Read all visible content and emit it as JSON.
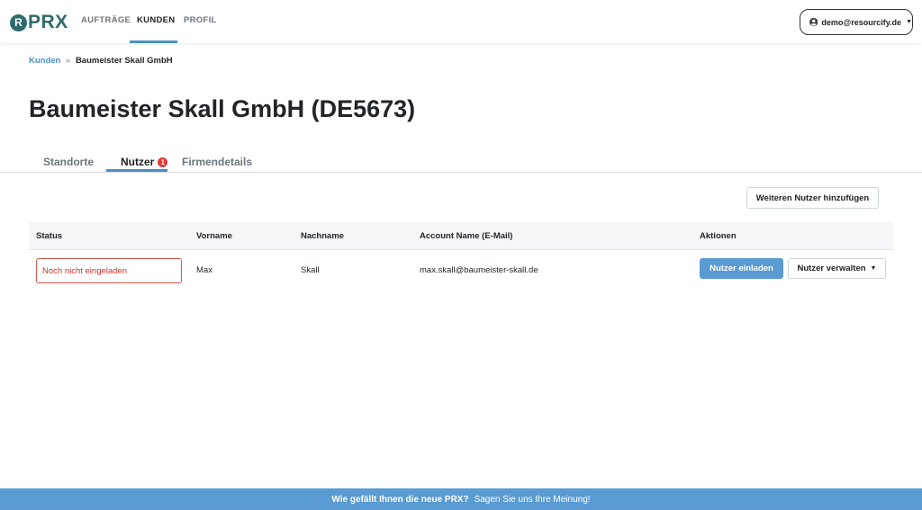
{
  "navbar": {
    "logo_text": "PRX",
    "logo_mark": "R",
    "links": [
      "AUFTRÄGE",
      "KUNDEN",
      "PROFIL"
    ],
    "active_link": "KUNDEN",
    "user_email": "demo@resourcify.de",
    "user_icon": "user-circle-icon"
  },
  "breadcrumb": {
    "parent": "Kunden",
    "separator": "»",
    "current": "Baumeister Skall GmbH"
  },
  "page_title": "Baumeister Skall GmbH (DE5673)",
  "tabs": [
    {
      "label": "Standorte"
    },
    {
      "label": "Nutzer",
      "badge": "1"
    },
    {
      "label": "Firmendetails"
    }
  ],
  "active_tab": "Nutzer",
  "add_user_label": "Weiteren Nutzer hinzufügen",
  "table": {
    "columns": [
      "Status",
      "Vorname",
      "Nachname",
      "Account Name (E-Mail)",
      "Aktionen"
    ],
    "rows": [
      {
        "status": "Noch nicht eingeladen",
        "first_name": "Max",
        "last_name": "Skall",
        "email": "max.skall@baumeister-skall.de",
        "invite_label": "Nutzer einladen",
        "manage_label": "Nutzer verwalten"
      }
    ]
  },
  "footer": {
    "question": "Wie gefällt Ihnen die neue PRX?",
    "cta": "Sagen Sie uns Ihre Meinung!"
  },
  "colors": {
    "accent": "#4a90c8",
    "primary_button": "#5a9bd3",
    "brand": "#2f6b6b",
    "status_error": "#d9534f",
    "badge": "#e53935"
  }
}
